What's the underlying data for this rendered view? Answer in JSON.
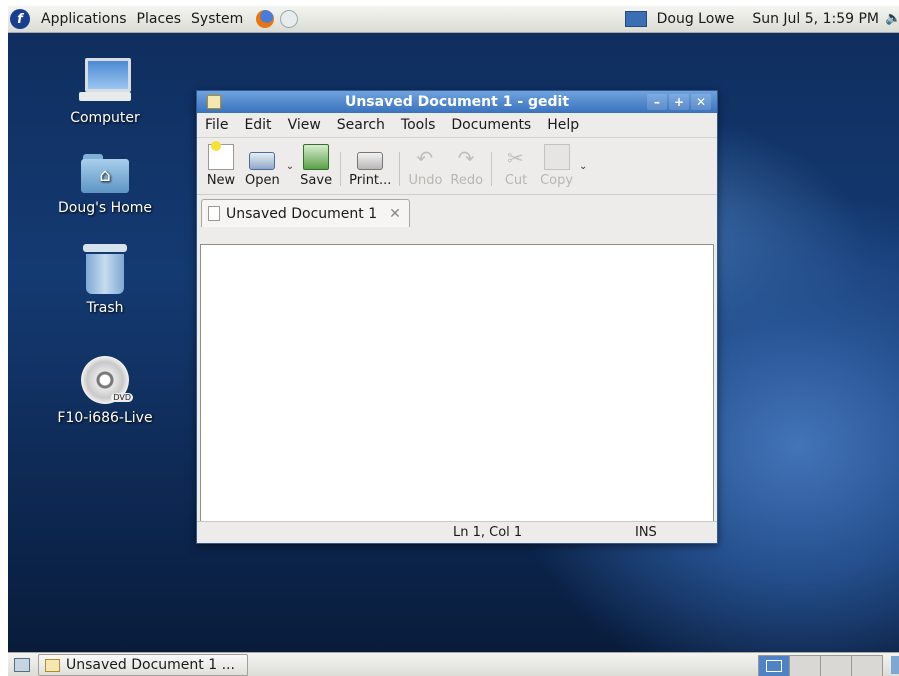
{
  "top_panel": {
    "menus": [
      "Applications",
      "Places",
      "System"
    ],
    "user": "Doug Lowe",
    "clock": "Sun Jul 5,  1:59 PM"
  },
  "desktop": {
    "icons": [
      {
        "label": "Computer",
        "icon": "computer-icon"
      },
      {
        "label": "Doug's Home",
        "icon": "home-folder-icon"
      },
      {
        "label": "Trash",
        "icon": "trash-icon"
      },
      {
        "label": "F10-i686-Live",
        "icon": "dvd-icon",
        "badge": "DVD"
      }
    ]
  },
  "window": {
    "title": "Unsaved Document 1 - gedit",
    "menu": [
      "File",
      "Edit",
      "View",
      "Search",
      "Tools",
      "Documents",
      "Help"
    ],
    "toolbar": {
      "new": "New",
      "open": "Open",
      "save": "Save",
      "print": "Print...",
      "undo": "Undo",
      "redo": "Redo",
      "cut": "Cut",
      "copy": "Copy"
    },
    "tab": {
      "label": "Unsaved Document 1",
      "close": "✕"
    },
    "editor_text": "",
    "status": {
      "position": "Ln 1, Col 1",
      "mode": "INS"
    }
  },
  "bottom_panel": {
    "task": "Unsaved Document 1 ..."
  },
  "colors": {
    "titlebar": "#3a72bd",
    "desktop": "#143a72"
  }
}
